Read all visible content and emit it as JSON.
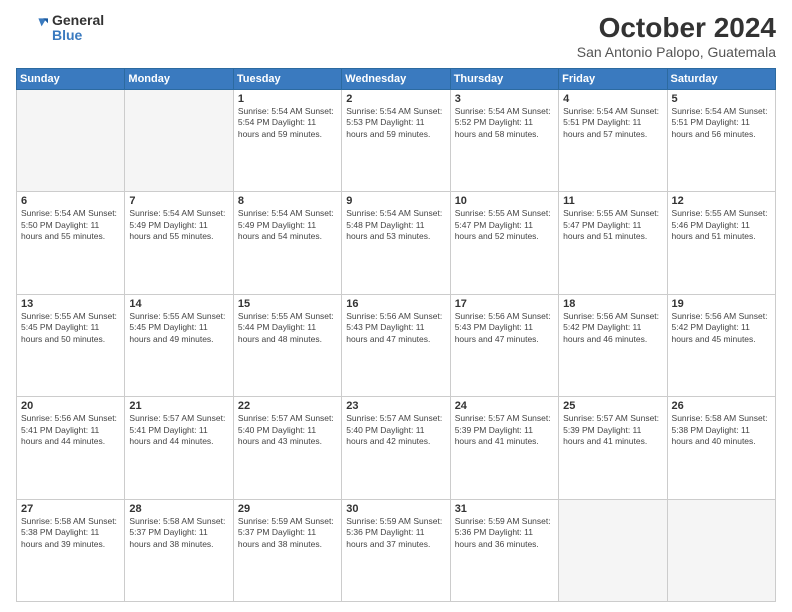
{
  "header": {
    "logo_general": "General",
    "logo_blue": "Blue",
    "month_title": "October 2024",
    "location": "San Antonio Palopo, Guatemala"
  },
  "days_of_week": [
    "Sunday",
    "Monday",
    "Tuesday",
    "Wednesday",
    "Thursday",
    "Friday",
    "Saturday"
  ],
  "weeks": [
    [
      {
        "day": "",
        "info": ""
      },
      {
        "day": "",
        "info": ""
      },
      {
        "day": "1",
        "info": "Sunrise: 5:54 AM\nSunset: 5:54 PM\nDaylight: 11 hours and 59 minutes."
      },
      {
        "day": "2",
        "info": "Sunrise: 5:54 AM\nSunset: 5:53 PM\nDaylight: 11 hours and 59 minutes."
      },
      {
        "day": "3",
        "info": "Sunrise: 5:54 AM\nSunset: 5:52 PM\nDaylight: 11 hours and 58 minutes."
      },
      {
        "day": "4",
        "info": "Sunrise: 5:54 AM\nSunset: 5:51 PM\nDaylight: 11 hours and 57 minutes."
      },
      {
        "day": "5",
        "info": "Sunrise: 5:54 AM\nSunset: 5:51 PM\nDaylight: 11 hours and 56 minutes."
      }
    ],
    [
      {
        "day": "6",
        "info": "Sunrise: 5:54 AM\nSunset: 5:50 PM\nDaylight: 11 hours and 55 minutes."
      },
      {
        "day": "7",
        "info": "Sunrise: 5:54 AM\nSunset: 5:49 PM\nDaylight: 11 hours and 55 minutes."
      },
      {
        "day": "8",
        "info": "Sunrise: 5:54 AM\nSunset: 5:49 PM\nDaylight: 11 hours and 54 minutes."
      },
      {
        "day": "9",
        "info": "Sunrise: 5:54 AM\nSunset: 5:48 PM\nDaylight: 11 hours and 53 minutes."
      },
      {
        "day": "10",
        "info": "Sunrise: 5:55 AM\nSunset: 5:47 PM\nDaylight: 11 hours and 52 minutes."
      },
      {
        "day": "11",
        "info": "Sunrise: 5:55 AM\nSunset: 5:47 PM\nDaylight: 11 hours and 51 minutes."
      },
      {
        "day": "12",
        "info": "Sunrise: 5:55 AM\nSunset: 5:46 PM\nDaylight: 11 hours and 51 minutes."
      }
    ],
    [
      {
        "day": "13",
        "info": "Sunrise: 5:55 AM\nSunset: 5:45 PM\nDaylight: 11 hours and 50 minutes."
      },
      {
        "day": "14",
        "info": "Sunrise: 5:55 AM\nSunset: 5:45 PM\nDaylight: 11 hours and 49 minutes."
      },
      {
        "day": "15",
        "info": "Sunrise: 5:55 AM\nSunset: 5:44 PM\nDaylight: 11 hours and 48 minutes."
      },
      {
        "day": "16",
        "info": "Sunrise: 5:56 AM\nSunset: 5:43 PM\nDaylight: 11 hours and 47 minutes."
      },
      {
        "day": "17",
        "info": "Sunrise: 5:56 AM\nSunset: 5:43 PM\nDaylight: 11 hours and 47 minutes."
      },
      {
        "day": "18",
        "info": "Sunrise: 5:56 AM\nSunset: 5:42 PM\nDaylight: 11 hours and 46 minutes."
      },
      {
        "day": "19",
        "info": "Sunrise: 5:56 AM\nSunset: 5:42 PM\nDaylight: 11 hours and 45 minutes."
      }
    ],
    [
      {
        "day": "20",
        "info": "Sunrise: 5:56 AM\nSunset: 5:41 PM\nDaylight: 11 hours and 44 minutes."
      },
      {
        "day": "21",
        "info": "Sunrise: 5:57 AM\nSunset: 5:41 PM\nDaylight: 11 hours and 44 minutes."
      },
      {
        "day": "22",
        "info": "Sunrise: 5:57 AM\nSunset: 5:40 PM\nDaylight: 11 hours and 43 minutes."
      },
      {
        "day": "23",
        "info": "Sunrise: 5:57 AM\nSunset: 5:40 PM\nDaylight: 11 hours and 42 minutes."
      },
      {
        "day": "24",
        "info": "Sunrise: 5:57 AM\nSunset: 5:39 PM\nDaylight: 11 hours and 41 minutes."
      },
      {
        "day": "25",
        "info": "Sunrise: 5:57 AM\nSunset: 5:39 PM\nDaylight: 11 hours and 41 minutes."
      },
      {
        "day": "26",
        "info": "Sunrise: 5:58 AM\nSunset: 5:38 PM\nDaylight: 11 hours and 40 minutes."
      }
    ],
    [
      {
        "day": "27",
        "info": "Sunrise: 5:58 AM\nSunset: 5:38 PM\nDaylight: 11 hours and 39 minutes."
      },
      {
        "day": "28",
        "info": "Sunrise: 5:58 AM\nSunset: 5:37 PM\nDaylight: 11 hours and 38 minutes."
      },
      {
        "day": "29",
        "info": "Sunrise: 5:59 AM\nSunset: 5:37 PM\nDaylight: 11 hours and 38 minutes."
      },
      {
        "day": "30",
        "info": "Sunrise: 5:59 AM\nSunset: 5:36 PM\nDaylight: 11 hours and 37 minutes."
      },
      {
        "day": "31",
        "info": "Sunrise: 5:59 AM\nSunset: 5:36 PM\nDaylight: 11 hours and 36 minutes."
      },
      {
        "day": "",
        "info": ""
      },
      {
        "day": "",
        "info": ""
      }
    ]
  ]
}
